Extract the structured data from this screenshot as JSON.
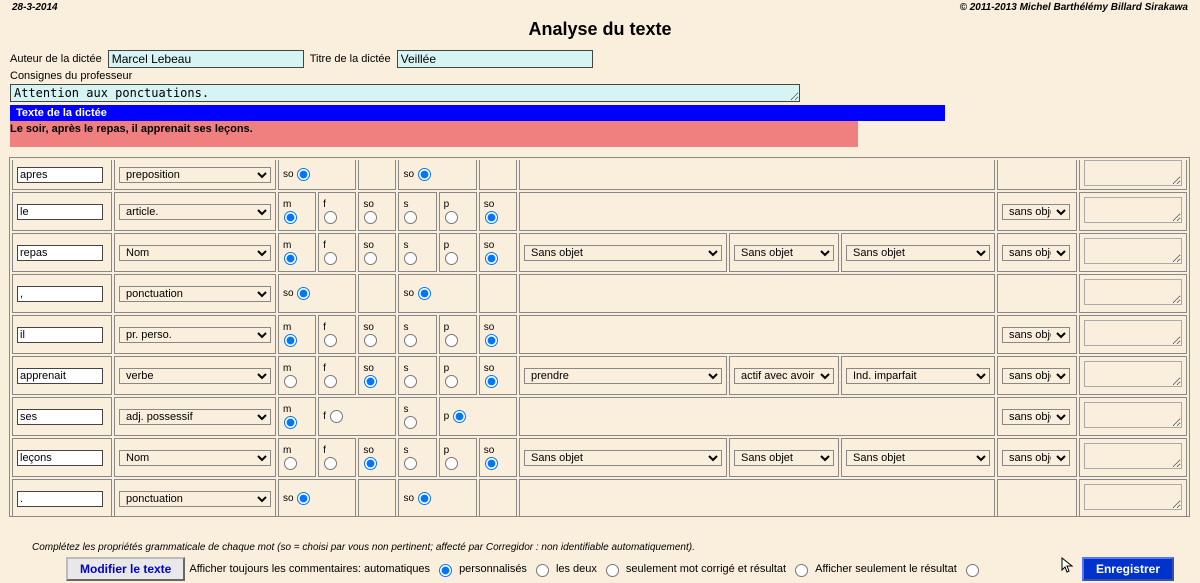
{
  "header": {
    "date": "28-3-2014",
    "copyright": "© 2011-2013 Michel Barthélémy Billard Sirakawa"
  },
  "title": "Analyse du texte",
  "form": {
    "author_label": "Auteur de la dictée",
    "author_value": "Marcel Lebeau",
    "title_label": "Titre de la dictée",
    "title_value": "Veillée",
    "instructions_label": "Consignes du professeur",
    "instructions_value": "Attention aux ponctuations."
  },
  "bands": {
    "dictation_heading": "Texte de la dictée",
    "dictation_text": "Le soir, après le repas, il apprenait ses leçons."
  },
  "headers_radio": [
    "m",
    "f",
    "so",
    "s",
    "p",
    "so"
  ],
  "rows": [
    {
      "word": "le",
      "cat": "article.",
      "gender": [
        "m",
        "f",
        "so"
      ],
      "number": [
        "s",
        "p",
        "so"
      ],
      "g_sel": 0,
      "n_sel": 2,
      "extra": "sans obje"
    },
    {
      "word": "repas",
      "cat": "Nom",
      "gender": [
        "m",
        "f",
        "so"
      ],
      "number": [
        "s",
        "p",
        "so"
      ],
      "g_sel": 0,
      "n_sel": 2,
      "c1": "Sans objet",
      "c2": "Sans objet",
      "c3": "Sans objet",
      "extra": "sans obje"
    },
    {
      "word": ",",
      "cat": "ponctuation",
      "so_only": true
    },
    {
      "word": "il",
      "cat": "pr. perso.",
      "gender": [
        "m",
        "f",
        "so"
      ],
      "number": [
        "s",
        "p",
        "so"
      ],
      "g_sel": 0,
      "n_sel": 2,
      "extra": "sans obje"
    },
    {
      "word": "apprenait",
      "cat": "verbe",
      "gender": [
        "m",
        "f",
        "so"
      ],
      "number": [
        "s",
        "p",
        "so"
      ],
      "g_sel": 2,
      "n_sel": 2,
      "c1": "prendre",
      "c2": "actif avec avoir",
      "c3": "Ind. imparfait",
      "extra": "sans obje"
    },
    {
      "word": "ses",
      "cat": "adj. possessif",
      "gender_custom": true,
      "number_custom": true,
      "extra": "sans obje"
    },
    {
      "word": "leçons",
      "cat": "Nom",
      "gender": [
        "m",
        "f",
        "so"
      ],
      "number": [
        "s",
        "p",
        "so"
      ],
      "g_sel": 2,
      "n_sel": 2,
      "c1": "Sans objet",
      "c2": "Sans objet",
      "c3": "Sans objet",
      "extra": "sans obje"
    },
    {
      "word": ".",
      "cat": "ponctuation",
      "so_only": true
    }
  ],
  "partial_row": {
    "word": "apres",
    "cat": "preposition",
    "so_text": "so"
  },
  "footer": {
    "note": "Complétez les propriétés grammaticale de chaque mot (so = choisi par vous non pertinent; affecté par Corregidor : non identifiable automatiquement).",
    "modify_btn": "Modifier le texte",
    "show_label": "Afficher toujours les commentaires: automatiques",
    "opt_pers": "personnalisés",
    "opt_both": "les deux",
    "opt_corr": "seulement mot corrigé et résultat",
    "opt_res": "Afficher seulement le résultat",
    "save_btn": "Enregistrer"
  }
}
